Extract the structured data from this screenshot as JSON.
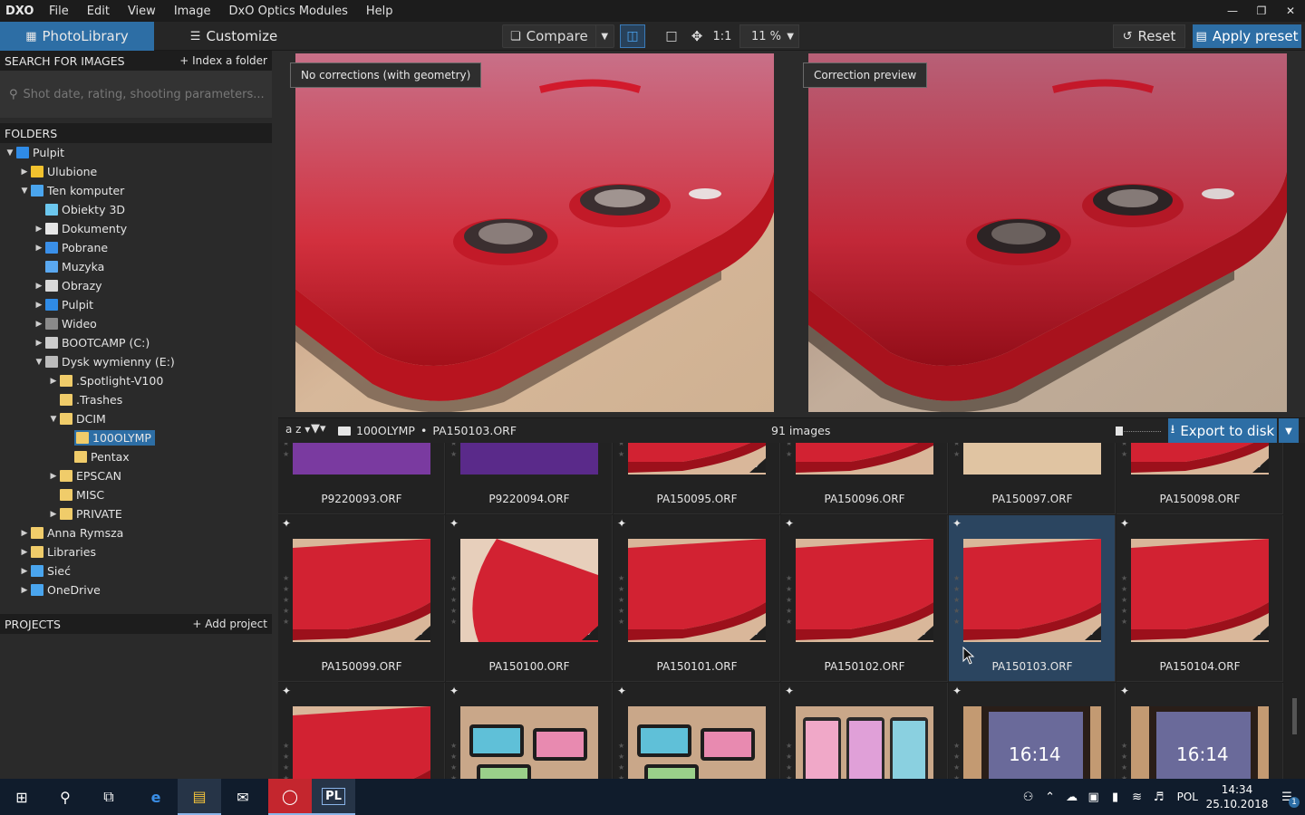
{
  "menubar": {
    "logo": "DXO",
    "items": [
      "File",
      "Edit",
      "View",
      "Image",
      "DxO Optics Modules",
      "Help"
    ]
  },
  "toolbar": {
    "tab_photolibrary": "PhotoLibrary",
    "tab_customize": "Customize",
    "compare_label": "Compare",
    "one_to_one": "1:1",
    "zoom": "11 %",
    "reset_label": "Reset",
    "apply_preset_label": "Apply preset"
  },
  "sidebar": {
    "search_header": "SEARCH FOR IMAGES",
    "index_folder": "+ Index a folder",
    "search_placeholder": "Shot date, rating, shooting parameters...",
    "folders_header": "FOLDERS",
    "projects_header": "PROJECTS",
    "add_project": "+ Add project",
    "tree": [
      {
        "label": "Pulpit",
        "depth": 0,
        "arrow": "down",
        "icon": "desktop"
      },
      {
        "label": "Ulubione",
        "depth": 1,
        "arrow": "right",
        "icon": "star"
      },
      {
        "label": "Ten komputer",
        "depth": 1,
        "arrow": "down",
        "icon": "computer"
      },
      {
        "label": "Obiekty 3D",
        "depth": 2,
        "arrow": "",
        "icon": "cube"
      },
      {
        "label": "Dokumenty",
        "depth": 2,
        "arrow": "right",
        "icon": "document"
      },
      {
        "label": "Pobrane",
        "depth": 2,
        "arrow": "right",
        "icon": "download"
      },
      {
        "label": "Muzyka",
        "depth": 2,
        "arrow": "",
        "icon": "music"
      },
      {
        "label": "Obrazy",
        "depth": 2,
        "arrow": "right",
        "icon": "picture"
      },
      {
        "label": "Pulpit",
        "depth": 2,
        "arrow": "right",
        "icon": "desktop"
      },
      {
        "label": "Wideo",
        "depth": 2,
        "arrow": "right",
        "icon": "video"
      },
      {
        "label": "BOOTCAMP (C:)",
        "depth": 2,
        "arrow": "right",
        "icon": "drive"
      },
      {
        "label": "Dysk wymienny (E:)",
        "depth": 2,
        "arrow": "down",
        "icon": "removable-drive"
      },
      {
        "label": ".Spotlight-V100",
        "depth": 3,
        "arrow": "right",
        "icon": "folder"
      },
      {
        "label": ".Trashes",
        "depth": 3,
        "arrow": "",
        "icon": "folder"
      },
      {
        "label": "DCIM",
        "depth": 3,
        "arrow": "down",
        "icon": "folder"
      },
      {
        "label": "100OLYMP",
        "depth": 4,
        "arrow": "",
        "icon": "folder",
        "selected": true
      },
      {
        "label": "Pentax",
        "depth": 4,
        "arrow": "",
        "icon": "folder"
      },
      {
        "label": "EPSCAN",
        "depth": 3,
        "arrow": "right",
        "icon": "folder"
      },
      {
        "label": "MISC",
        "depth": 3,
        "arrow": "",
        "icon": "folder"
      },
      {
        "label": "PRIVATE",
        "depth": 3,
        "arrow": "right",
        "icon": "folder"
      },
      {
        "label": "Anna Rymsza",
        "depth": 1,
        "arrow": "right",
        "icon": "folder"
      },
      {
        "label": "Libraries",
        "depth": 1,
        "arrow": "right",
        "icon": "library"
      },
      {
        "label": "Sieć",
        "depth": 1,
        "arrow": "right",
        "icon": "network"
      },
      {
        "label": "OneDrive",
        "depth": 1,
        "arrow": "right",
        "icon": "cloud"
      }
    ]
  },
  "viewer": {
    "left_label": "No corrections (with geometry)",
    "right_label": "Correction preview"
  },
  "filmbar": {
    "sort_label": "a z",
    "breadcrumb_folder": "100OLYMP",
    "breadcrumb_sep": "•",
    "breadcrumb_file": "PA150103.ORF",
    "count": "91 images",
    "export_label": "Export to disk"
  },
  "grid": {
    "rows": [
      [
        {
          "name": "P9220093.ORF",
          "kind": "purple",
          "check": false,
          "selected": false
        },
        {
          "name": "P9220094.ORF",
          "kind": "purple2",
          "check": false,
          "selected": false
        },
        {
          "name": "PA150095.ORF",
          "kind": "red",
          "check": true,
          "selected": false
        },
        {
          "name": "PA150096.ORF",
          "kind": "red",
          "check": false,
          "selected": false
        },
        {
          "name": "PA150097.ORF",
          "kind": "beige",
          "check": false,
          "selected": false
        },
        {
          "name": "PA150098.ORF",
          "kind": "red",
          "check": true,
          "selected": false
        }
      ],
      [
        {
          "name": "PA150099.ORF",
          "kind": "red",
          "check": true,
          "selected": false
        },
        {
          "name": "PA150100.ORF",
          "kind": "beige-red",
          "check": true,
          "selected": false
        },
        {
          "name": "PA150101.ORF",
          "kind": "red",
          "check": true,
          "selected": false
        },
        {
          "name": "PA150102.ORF",
          "kind": "red",
          "check": true,
          "selected": false
        },
        {
          "name": "PA150103.ORF",
          "kind": "red",
          "check": true,
          "selected": true
        },
        {
          "name": "PA150104.ORF",
          "kind": "red",
          "check": true,
          "selected": false
        }
      ],
      [
        {
          "name": "",
          "kind": "red",
          "check": false,
          "selected": false
        },
        {
          "name": "",
          "kind": "phones",
          "check": false,
          "selected": false
        },
        {
          "name": "",
          "kind": "phones",
          "check": false,
          "selected": false
        },
        {
          "name": "",
          "kind": "phones-pink",
          "check": false,
          "selected": false
        },
        {
          "name": "",
          "kind": "phone-screen",
          "check": false,
          "selected": false
        },
        {
          "name": "",
          "kind": "phone-screen",
          "check": false,
          "selected": false
        }
      ]
    ]
  },
  "taskbar": {
    "active_app": "PL",
    "language": "POL",
    "time": "14:34",
    "date": "25.10.2018",
    "notification_count": "1"
  },
  "colors": {
    "accent": "#2d6ea5",
    "taskbar": "#101c2c",
    "selection_cell": "#2b4560"
  }
}
